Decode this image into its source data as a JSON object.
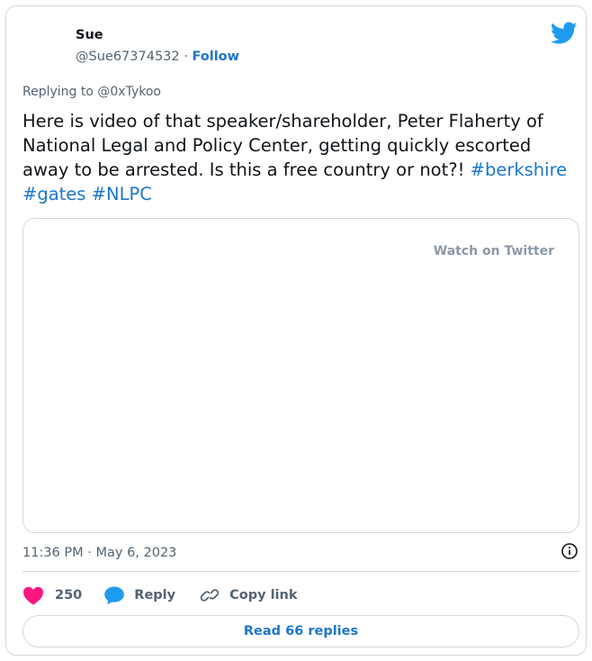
{
  "author": {
    "name": "Sue",
    "handle": "@Sue67374532",
    "separator": " · ",
    "follow_label": "Follow"
  },
  "reply_to": "Replying to @0xTykoo",
  "tweet": {
    "text": "Here is video of that speaker/shareholder, Peter Flaherty of National Legal and Policy Center, getting quickly escorted away to be arrested. Is this a free country or not?! ",
    "hashtags": [
      "#berkshire",
      "#gates",
      "#NLPC"
    ]
  },
  "media": {
    "watch_label": "Watch on Twitter"
  },
  "timestamp": "11:36 PM · May 6, 2023",
  "actions": {
    "like_count": "250",
    "reply_label": "Reply",
    "copy_label": "Copy link"
  },
  "read_replies_label": "Read 66 replies",
  "colors": {
    "link": "#1d76c9",
    "like": "#f91880",
    "bird": "#1d9bf0",
    "border": "#cfd9de",
    "muted": "#536471"
  },
  "icons": [
    "twitter-bird-icon",
    "info-icon",
    "heart-icon",
    "reply-bubble-icon",
    "link-icon"
  ]
}
